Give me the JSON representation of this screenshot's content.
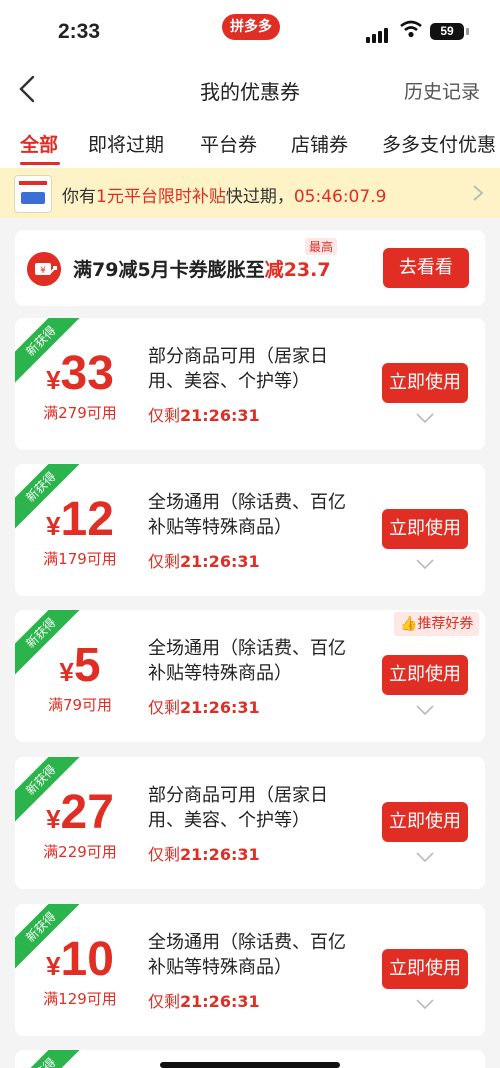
{
  "status": {
    "time": "2:33",
    "brand": "拼多多",
    "battery": "59"
  },
  "nav": {
    "title": "我的优惠券",
    "right": "历史记录"
  },
  "tabs": [
    "全部",
    "即将过期",
    "平台券",
    "店铺券",
    "多多支付优惠"
  ],
  "notice": {
    "prefix": "你有",
    "highlight": "1元平台限时补贴",
    "middle": "快过期，",
    "countdown": "05:46:07.9"
  },
  "promo": {
    "text_main": "满79减5月卡券膨胀至",
    "text_red1": "减",
    "text_red2": "23.7",
    "badge": "最高",
    "button": "去看看"
  },
  "coupons": [
    {
      "badge": "新获得",
      "symbol": "¥",
      "amount": "33",
      "condition": "满279可用",
      "desc": "部分商品可用（居家日用、美容、个护等）",
      "expire_prefix": "仅剩",
      "expire_time": "21:26:31",
      "button": "立即使用"
    },
    {
      "badge": "新获得",
      "symbol": "¥",
      "amount": "12",
      "condition": "满179可用",
      "desc": "全场通用（除话费、百亿补贴等特殊商品）",
      "expire_prefix": "仅剩",
      "expire_time": "21:26:31",
      "button": "立即使用"
    },
    {
      "badge": "新获得",
      "symbol": "¥",
      "amount": "5",
      "condition": "满79可用",
      "desc": "全场通用（除话费、百亿补贴等特殊商品）",
      "expire_prefix": "仅剩",
      "expire_time": "21:26:31",
      "button": "立即使用",
      "tag": "推荐好券"
    },
    {
      "badge": "新获得",
      "symbol": "¥",
      "amount": "27",
      "condition": "满229可用",
      "desc": "部分商品可用（居家日用、美容、个护等）",
      "expire_prefix": "仅剩",
      "expire_time": "21:26:31",
      "button": "立即使用"
    },
    {
      "badge": "新获得",
      "symbol": "¥",
      "amount": "10",
      "condition": "满129可用",
      "desc": "全场通用（除话费、百亿补贴等特殊商品）",
      "expire_prefix": "仅剩",
      "expire_time": "21:26:31",
      "button": "立即使用"
    },
    {
      "badge": "新获得"
    }
  ],
  "colors": {
    "accent": "#e02e24",
    "ribbon": "#2bb44b",
    "notice_bg": "#fdf3c7"
  }
}
